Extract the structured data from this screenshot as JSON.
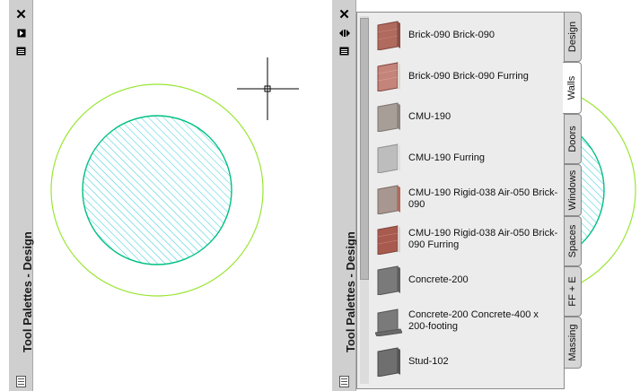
{
  "left_palette": {
    "title": "Tool Palettes - Design"
  },
  "right_palette": {
    "title": "Tool Palettes - Design",
    "tabs": [
      {
        "label": "Design",
        "active": false
      },
      {
        "label": "Walls",
        "active": true
      },
      {
        "label": "Doors",
        "active": false
      },
      {
        "label": "Windows",
        "active": false
      },
      {
        "label": "Spaces",
        "active": false
      },
      {
        "label": "FF + E",
        "active": false
      },
      {
        "label": "Massing",
        "active": false
      }
    ],
    "tools": [
      {
        "label": "Brick-090 Brick-090",
        "icon": "brick-wall-icon"
      },
      {
        "label": "Brick-090 Brick-090 Furring",
        "icon": "brick-furring-wall-icon"
      },
      {
        "label": "CMU-190",
        "icon": "cmu-wall-icon"
      },
      {
        "label": "CMU-190 Furring",
        "icon": "cmu-furring-wall-icon"
      },
      {
        "label": "CMU-190 Rigid-038 Air-050 Brick-090",
        "icon": "cmu-brick-wall-icon"
      },
      {
        "label": "CMU-190 Rigid-038 Air-050 Brick-090 Furring",
        "icon": "cmu-brick-furring-wall-icon"
      },
      {
        "label": "Concrete-200",
        "icon": "concrete-wall-icon"
      },
      {
        "label": "Concrete-200 Concrete-400 x 200-footing",
        "icon": "concrete-footing-wall-icon"
      },
      {
        "label": "Stud-102",
        "icon": "stud-wall-icon"
      }
    ]
  },
  "colors": {
    "outer_circle": "#99e633",
    "inner_circle": "#00c080",
    "hatch": "#33ccdd",
    "brick": "#b06a5e",
    "cmu": "#a89e98",
    "concrete": "#7a7a7a"
  }
}
